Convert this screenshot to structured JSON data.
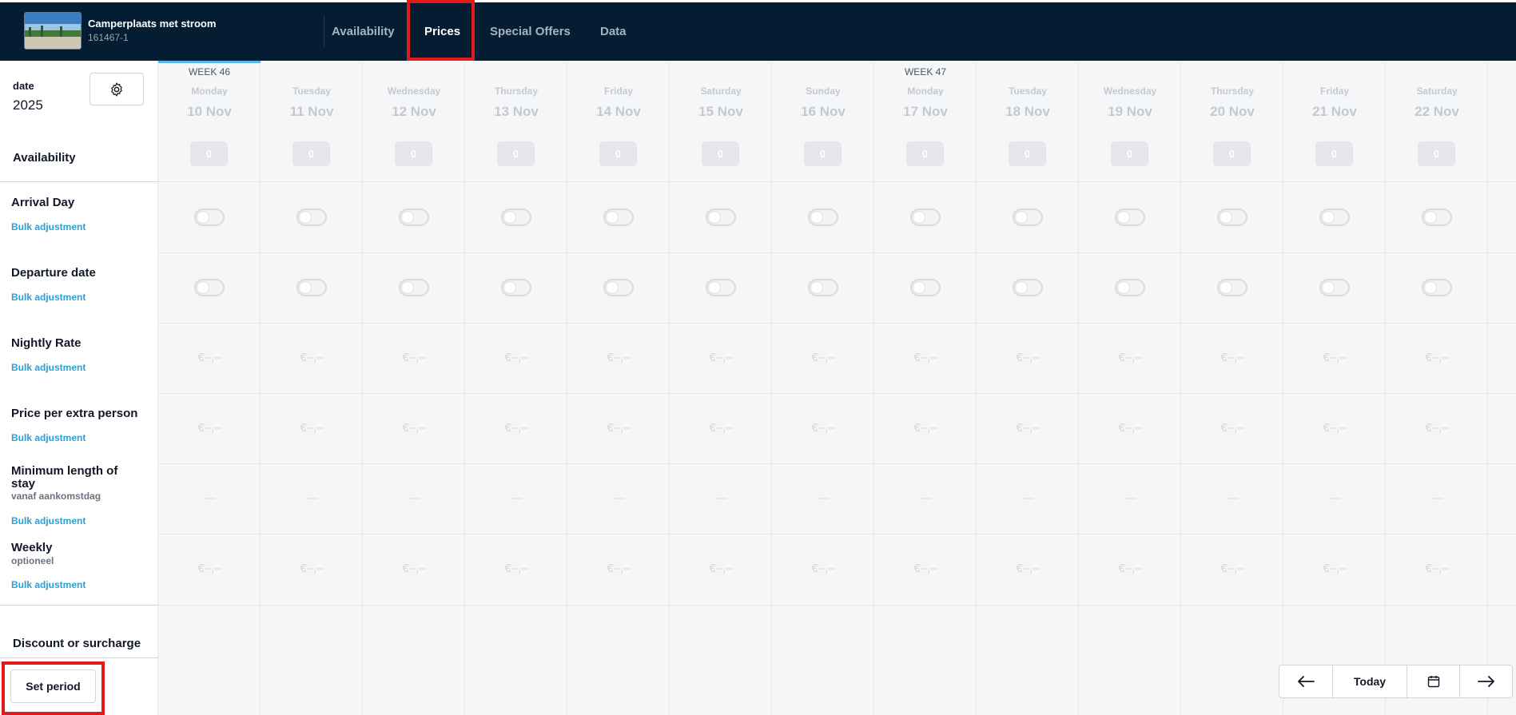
{
  "header": {
    "property_title": "Camperplaats met stroom",
    "property_id": "161467-1",
    "tabs": [
      {
        "label": "Availability",
        "active": false
      },
      {
        "label": "Prices",
        "active": true
      },
      {
        "label": "Special Offers",
        "active": false
      },
      {
        "label": "Data",
        "active": false
      }
    ]
  },
  "sidebar": {
    "date_label": "date",
    "year": "2025",
    "availability_label": "Availability",
    "rows": [
      {
        "title": "Arrival Day",
        "sub": "",
        "link": "Bulk adjustment"
      },
      {
        "title": "Departure date",
        "sub": "",
        "link": "Bulk adjustment"
      },
      {
        "title": "Nightly Rate",
        "sub": "",
        "link": "Bulk adjustment"
      },
      {
        "title": "Price per extra person",
        "sub": "",
        "link": "Bulk adjustment"
      },
      {
        "title": "Minimum length of stay",
        "sub": "vanaf aankomstdag",
        "link": "Bulk adjustment"
      },
      {
        "title": "Weekly",
        "sub": "optioneel",
        "link": "Bulk adjustment"
      }
    ],
    "discount_label": "Discount or surcharge",
    "set_period_label": "Set period"
  },
  "calendar": {
    "days": [
      {
        "week": "WEEK 46",
        "name": "Monday",
        "date": "10 Nov",
        "availability": "0",
        "nightly": "€–,–",
        "extra_person": "€–,–",
        "min_stay": "—",
        "weekly": "€–,–"
      },
      {
        "week": "",
        "name": "Tuesday",
        "date": "11 Nov",
        "availability": "0",
        "nightly": "€–,–",
        "extra_person": "€–,–",
        "min_stay": "—",
        "weekly": "€–,–"
      },
      {
        "week": "",
        "name": "Wednesday",
        "date": "12 Nov",
        "availability": "0",
        "nightly": "€–,–",
        "extra_person": "€–,–",
        "min_stay": "—",
        "weekly": "€–,–"
      },
      {
        "week": "",
        "name": "Thursday",
        "date": "13 Nov",
        "availability": "0",
        "nightly": "€–,–",
        "extra_person": "€–,–",
        "min_stay": "—",
        "weekly": "€–,–"
      },
      {
        "week": "",
        "name": "Friday",
        "date": "14 Nov",
        "availability": "0",
        "nightly": "€–,–",
        "extra_person": "€–,–",
        "min_stay": "—",
        "weekly": "€–,–"
      },
      {
        "week": "",
        "name": "Saturday",
        "date": "15 Nov",
        "availability": "0",
        "nightly": "€–,–",
        "extra_person": "€–,–",
        "min_stay": "—",
        "weekly": "€–,–"
      },
      {
        "week": "",
        "name": "Sunday",
        "date": "16 Nov",
        "availability": "0",
        "nightly": "€–,–",
        "extra_person": "€–,–",
        "min_stay": "—",
        "weekly": "€–,–"
      },
      {
        "week": "WEEK 47",
        "name": "Monday",
        "date": "17 Nov",
        "availability": "0",
        "nightly": "€–,–",
        "extra_person": "€–,–",
        "min_stay": "—",
        "weekly": "€–,–"
      },
      {
        "week": "",
        "name": "Tuesday",
        "date": "18 Nov",
        "availability": "0",
        "nightly": "€–,–",
        "extra_person": "€–,–",
        "min_stay": "—",
        "weekly": "€–,–"
      },
      {
        "week": "",
        "name": "Wednesday",
        "date": "19 Nov",
        "availability": "0",
        "nightly": "€–,–",
        "extra_person": "€–,–",
        "min_stay": "—",
        "weekly": "€–,–"
      },
      {
        "week": "",
        "name": "Thursday",
        "date": "20 Nov",
        "availability": "0",
        "nightly": "€–,–",
        "extra_person": "€–,–",
        "min_stay": "—",
        "weekly": "€–,–"
      },
      {
        "week": "",
        "name": "Friday",
        "date": "21 Nov",
        "availability": "0",
        "nightly": "€–,–",
        "extra_person": "€–,–",
        "min_stay": "—",
        "weekly": "€–,–"
      },
      {
        "week": "",
        "name": "Saturday",
        "date": "22 Nov",
        "availability": "0",
        "nightly": "€–,–",
        "extra_person": "€–,–",
        "min_stay": "—",
        "weekly": "€–,–"
      }
    ]
  },
  "pager": {
    "prev_icon": "arrow-left-icon",
    "today_label": "Today",
    "calendar_icon": "calendar-icon",
    "next_icon": "arrow-right-icon"
  },
  "colors": {
    "topbar": "#041d32",
    "highlight": "#e21a1a",
    "link": "#2b9fd8",
    "current_week_bar": "#5bb4e5"
  }
}
